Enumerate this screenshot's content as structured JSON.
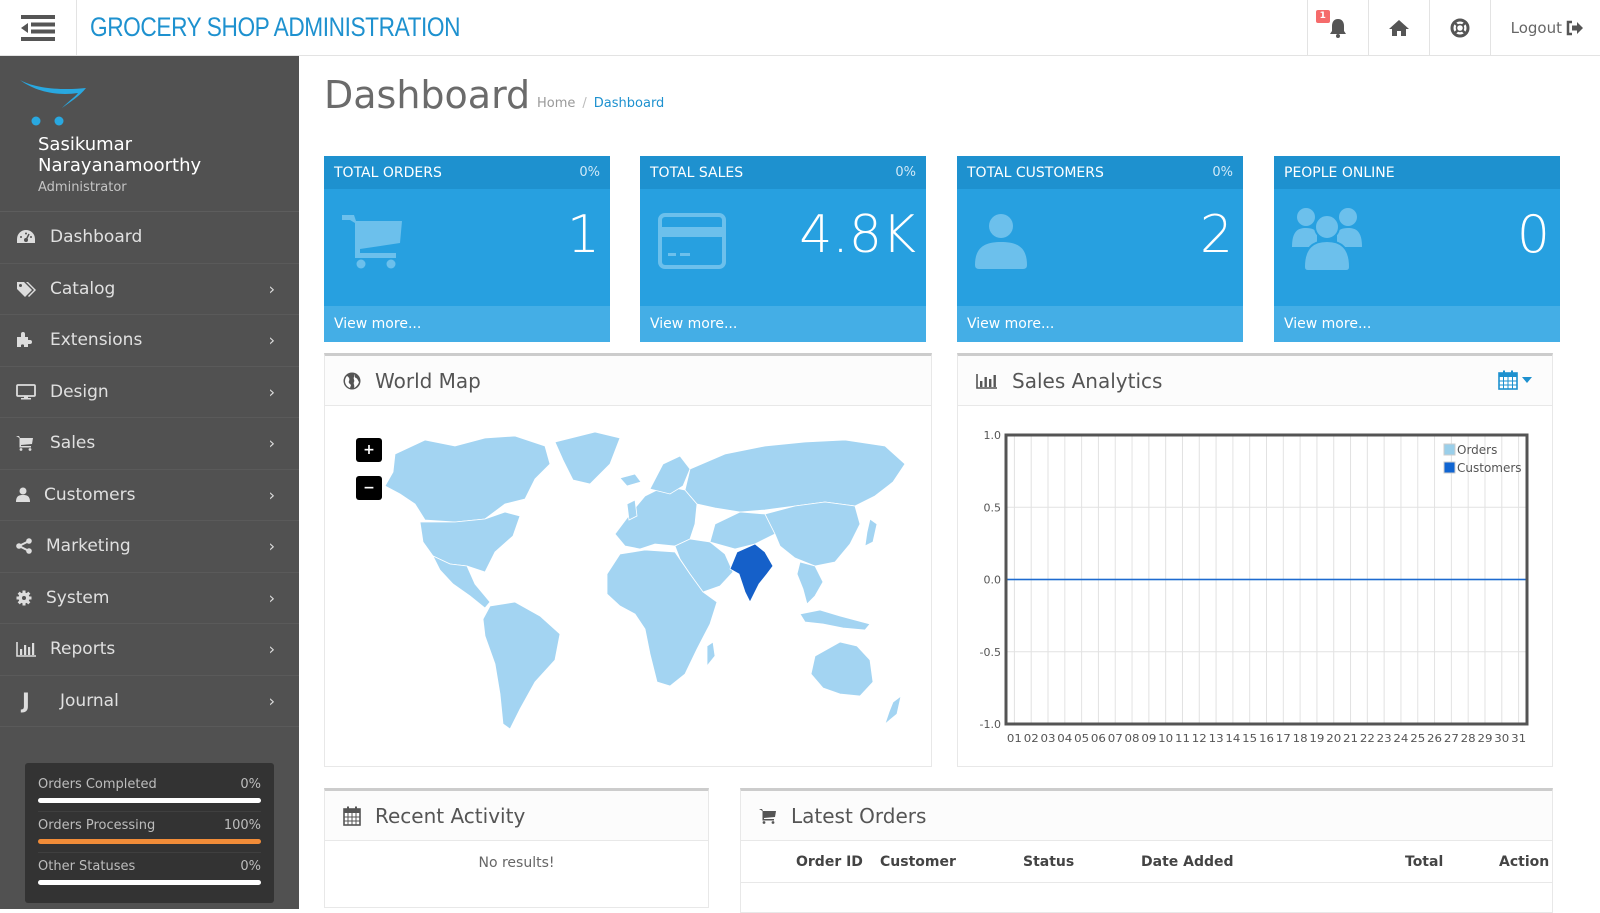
{
  "header": {
    "brand": "GROCERY SHOP ADMINISTRATION",
    "notification_count": "1",
    "logout_label": "Logout",
    "icons": [
      "menu-toggle-icon",
      "bell-icon",
      "home-icon",
      "life-ring-icon",
      "sign-out-icon"
    ]
  },
  "sidebar": {
    "user_name_line1": "Sasikumar",
    "user_name_line2": "Narayanamoorthy",
    "user_role": "Administrator",
    "items": [
      {
        "label": "Dashboard",
        "icon": "dashboard-icon",
        "has_children": false
      },
      {
        "label": "Catalog",
        "icon": "tags-icon",
        "has_children": true
      },
      {
        "label": "Extensions",
        "icon": "puzzle-icon",
        "has_children": true
      },
      {
        "label": "Design",
        "icon": "desktop-icon",
        "has_children": true
      },
      {
        "label": "Sales",
        "icon": "cart-icon",
        "has_children": true
      },
      {
        "label": "Customers",
        "icon": "user-icon",
        "has_children": true
      },
      {
        "label": "Marketing",
        "icon": "share-icon",
        "has_children": true
      },
      {
        "label": "System",
        "icon": "gear-icon",
        "has_children": true
      },
      {
        "label": "Reports",
        "icon": "bar-chart-icon",
        "has_children": true
      },
      {
        "label": "Journal",
        "icon": "journal-j-icon",
        "has_children": true
      }
    ],
    "stats": [
      {
        "label": "Orders Completed",
        "value": "0%",
        "percent": 0,
        "color": "#ffffff"
      },
      {
        "label": "Orders Processing",
        "value": "100%",
        "percent": 100,
        "color": "#f28c38"
      },
      {
        "label": "Other Statuses",
        "value": "0%",
        "percent": 0,
        "color": "#ffffff"
      }
    ]
  },
  "main": {
    "title": "Dashboard",
    "breadcrumb": [
      {
        "label": "Home"
      },
      {
        "label": "Dashboard"
      }
    ],
    "tiles": [
      {
        "title": "TOTAL ORDERS",
        "percent": "0%",
        "value": "1",
        "icon": "shopping-cart-icon",
        "link": "View more..."
      },
      {
        "title": "TOTAL SALES",
        "percent": "0%",
        "value": "4.8K",
        "icon": "credit-card-icon",
        "link": "View more..."
      },
      {
        "title": "TOTAL CUSTOMERS",
        "percent": "0%",
        "value": "2",
        "icon": "user-icon",
        "link": "View more..."
      },
      {
        "title": "PEOPLE ONLINE",
        "percent": "",
        "value": "0",
        "icon": "users-icon",
        "link": "View more..."
      }
    ],
    "world_map": {
      "title": "World Map",
      "zoom_in": "+",
      "zoom_out": "−",
      "highlighted_country": "India",
      "base_color": "#a3d4f2",
      "highlight_color": "#1560c9"
    },
    "sales_analytics": {
      "title": "Sales Analytics"
    },
    "recent_activity": {
      "title": "Recent Activity",
      "empty_text": "No results!"
    },
    "latest_orders": {
      "title": "Latest Orders",
      "columns": [
        "Order ID",
        "Customer",
        "Status",
        "Date Added",
        "Total",
        "Action"
      ],
      "rows": []
    }
  },
  "chart_data": {
    "type": "line",
    "title": "Sales Analytics",
    "xlabel": "",
    "ylabel": "",
    "x": [
      "01",
      "02",
      "03",
      "04",
      "05",
      "06",
      "07",
      "08",
      "09",
      "10",
      "11",
      "12",
      "13",
      "14",
      "15",
      "16",
      "17",
      "18",
      "19",
      "20",
      "21",
      "22",
      "23",
      "24",
      "25",
      "26",
      "27",
      "28",
      "29",
      "30",
      "31"
    ],
    "ylim": [
      -1.0,
      1.0
    ],
    "yticks": [
      "1.0",
      "0.5",
      "0.0",
      "-0.5",
      "-1.0"
    ],
    "ytick_values": [
      1.0,
      0.5,
      0.0,
      -0.5,
      -1.0
    ],
    "grid": true,
    "legend_position": "top-right",
    "series": [
      {
        "name": "Orders",
        "color": "#9acfea",
        "values": [
          0,
          0,
          0,
          0,
          0,
          0,
          0,
          0,
          0,
          0,
          0,
          0,
          0,
          0,
          0,
          0,
          0,
          0,
          0,
          0,
          0,
          0,
          0,
          0,
          0,
          0,
          0,
          0,
          0,
          0,
          0
        ]
      },
      {
        "name": "Customers",
        "color": "#1065d2",
        "values": [
          0,
          0,
          0,
          0,
          0,
          0,
          0,
          0,
          0,
          0,
          0,
          0,
          0,
          0,
          0,
          0,
          0,
          0,
          0,
          0,
          0,
          0,
          0,
          0,
          0,
          0,
          0,
          0,
          0,
          0,
          0
        ]
      }
    ]
  }
}
